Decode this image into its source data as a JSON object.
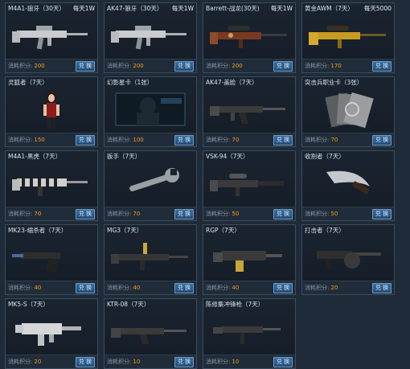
{
  "shop": {
    "price_label": "消耗积分:",
    "redeem_label": "兑 换",
    "items": [
      {
        "name": "M4A1-狼牙（30天）",
        "extra": "每天1W",
        "cost": "200",
        "art": "rifle"
      },
      {
        "name": "AK47-狼牙（30天）",
        "extra": "每天1W",
        "cost": "200",
        "art": "rifle"
      },
      {
        "name": "Barrett-战龙(30天)",
        "extra": "每天1W",
        "cost": "200",
        "art": "sniper-red"
      },
      {
        "name": "黄金AWM（7天）",
        "extra": "每天5000",
        "cost": "170",
        "art": "sniper-gold"
      },
      {
        "name": "灵狐者（7天）",
        "extra": "",
        "cost": "150",
        "art": "character"
      },
      {
        "name": "幻影星卡（1张）",
        "extra": "",
        "cost": "100",
        "art": "card"
      },
      {
        "name": "AK47-盖脸（7天）",
        "extra": "",
        "cost": "70",
        "art": "ak"
      },
      {
        "name": "突击兵职业卡（3张）",
        "extra": "",
        "cost": "70",
        "art": "cards"
      },
      {
        "name": "M4A1-黑虎（7天）",
        "extra": "",
        "cost": "70",
        "art": "tiger"
      },
      {
        "name": "扳手（7天）",
        "extra": "",
        "cost": "70",
        "art": "wrench"
      },
      {
        "name": "VSK-94（7天）",
        "extra": "",
        "cost": "50",
        "art": "vsk"
      },
      {
        "name": "收割者（7天）",
        "extra": "",
        "cost": "50",
        "art": "machete"
      },
      {
        "name": "MK23-缩杀者（7天）",
        "extra": "",
        "cost": "40",
        "art": "pistol"
      },
      {
        "name": "MG3（7天）",
        "extra": "",
        "cost": "40",
        "art": "mg"
      },
      {
        "name": "RGP（7天）",
        "extra": "",
        "cost": "40",
        "art": "rgp"
      },
      {
        "name": "打击者（7天）",
        "extra": "",
        "cost": "20",
        "art": "striker"
      },
      {
        "name": "MK5-S（7天）",
        "extra": "",
        "cost": "20",
        "art": "vector"
      },
      {
        "name": "KTR-08（7天）",
        "extra": "",
        "cost": "10",
        "art": "ktr"
      },
      {
        "name": "陈修集冲锋枪（7天）",
        "extra": "",
        "cost": "10",
        "art": "smg"
      }
    ]
  }
}
